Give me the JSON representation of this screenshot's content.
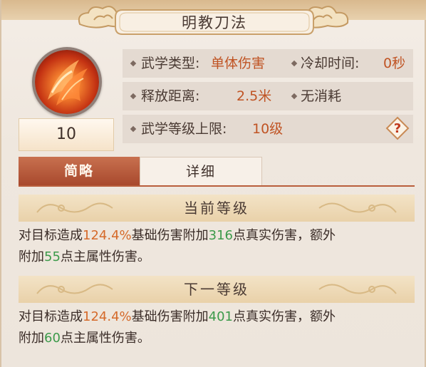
{
  "skill": {
    "name": "明教刀法",
    "level": "10"
  },
  "info": {
    "type_label": "武学类型:",
    "type_value": "单体伤害",
    "cooldown_label": "冷却时间:",
    "cooldown_value": "0秒",
    "range_label": "释放距离:",
    "range_value": "2.5米",
    "cost_value": "无消耗",
    "max_level_label": "武学等级上限:",
    "max_level_value": "10级",
    "help_symbol": "?"
  },
  "tabs": [
    {
      "label": "简略",
      "active": true
    },
    {
      "label": "详细",
      "active": false
    }
  ],
  "current": {
    "header": "当前等级",
    "line1_a": "对目标造成",
    "line1_pct": "124.4%",
    "line1_b": "基础伤害附加",
    "line1_num": "316",
    "line1_c": "点真实伤害，额外",
    "line2_a": "附加",
    "line2_num": "55",
    "line2_b": "点主属性伤害。"
  },
  "next": {
    "header": "下一等级",
    "line1_a": "对目标造成",
    "line1_pct": "124.4%",
    "line1_b": "基础伤害附加",
    "line1_num": "401",
    "line1_c": "点真实伤害，额外",
    "line2_a": "附加",
    "line2_num": "60",
    "line2_b": "点主属性伤害。"
  },
  "colors": {
    "accent": "#b95e3c",
    "value_orange": "#c05424",
    "highlight_orange": "#d56a2a",
    "highlight_green": "#3c9a4a"
  }
}
